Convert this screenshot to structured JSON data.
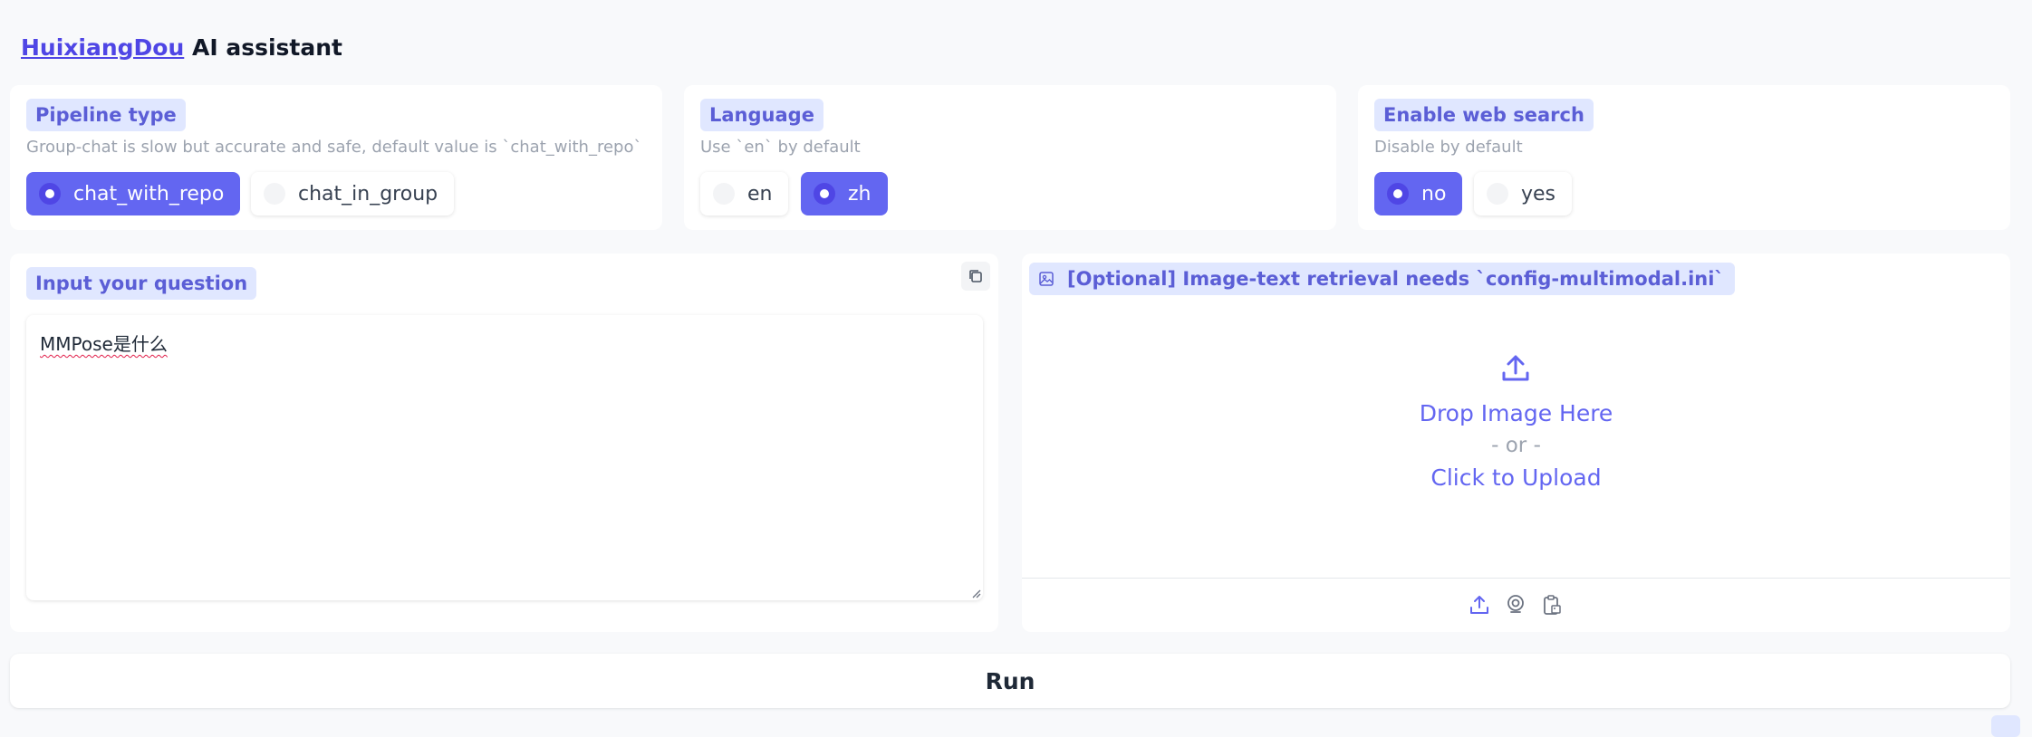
{
  "header": {
    "link_text": "HuixiangDou",
    "title_rest": " AI assistant"
  },
  "pipeline": {
    "label": "Pipeline type",
    "description": "Group-chat is slow but accurate and safe, default value is `chat_with_repo`",
    "options": [
      "chat_with_repo",
      "chat_in_group"
    ],
    "selected": "chat_with_repo"
  },
  "language": {
    "label": "Language",
    "description": "Use `en` by default",
    "options": [
      "en",
      "zh"
    ],
    "selected": "zh"
  },
  "web_search": {
    "label": "Enable web search",
    "description": "Disable by default",
    "options": [
      "no",
      "yes"
    ],
    "selected": "no"
  },
  "question": {
    "label": "Input your question",
    "value": "MMPose是什么"
  },
  "image_upload": {
    "label": "[Optional] Image-text retrieval needs `config-multimodal.ini`",
    "drop_text": "Drop Image Here",
    "or_text": "- or -",
    "click_text": "Click to Upload"
  },
  "run_label": "Run",
  "colors": {
    "accent": "#6366f1",
    "badge_bg": "#e0e7ff",
    "badge_text": "#5b5ed6",
    "page_bg": "#f8f9fb"
  }
}
